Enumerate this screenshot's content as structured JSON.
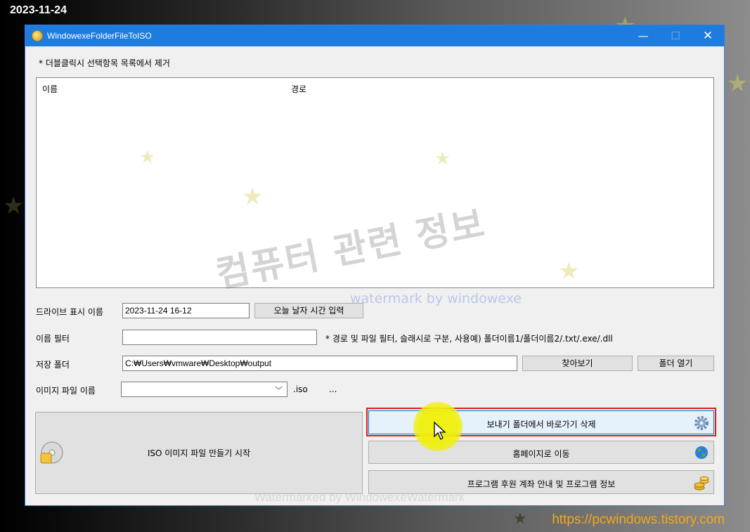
{
  "overlay": {
    "date_stamp": "2023-11-24",
    "site_url": "https://pcwindows.tistory.com",
    "watermark_text": "컴퓨터 관련 정보",
    "watermark_sub": "watermark by windowexe",
    "watermark_bottom": "Watermarked by WindowexeWatermark"
  },
  "window": {
    "title": "WindowexeFolderFileToISO",
    "controls": {
      "minimize": "—",
      "maximize": "☐",
      "close": "✕"
    }
  },
  "hint": "* 더블클릭시 선택항목 목록에서 제거",
  "list": {
    "columns": [
      "이름",
      "경로"
    ]
  },
  "drive_label": {
    "label": "드라이브 표시 이름",
    "value": "2023-11-24 16-12",
    "button": "오늘 날자 시간 입력"
  },
  "name_filter": {
    "label": "이름 필터",
    "value": "",
    "hint": "* 경로 및 파일 필터, 슬래시로 구분, 사용예) 폴더이름1/폴더이름2/.txt/.exe/.dll"
  },
  "save_folder": {
    "label": "저장 폴더",
    "value": "C:₩Users₩vmware₩Desktop₩output",
    "browse_button": "찾아보기",
    "open_button": "폴더 열기"
  },
  "image_name": {
    "label": "이미지 파일 이름",
    "value": "",
    "extension": ".iso",
    "more": "..."
  },
  "actions": {
    "create_iso": "ISO 이미지 파일 만들기 시작",
    "delete_shortcut": "보내기 폴더에서 바로가기 삭제",
    "homepage": "홈페이지로 이동",
    "info": "프로그램 후원 계좌 안내 및 프로그램 정보"
  },
  "colors": {
    "titlebar": "#1e7ce0",
    "highlight": "#d42020",
    "active_button": "#e5f1fb"
  }
}
